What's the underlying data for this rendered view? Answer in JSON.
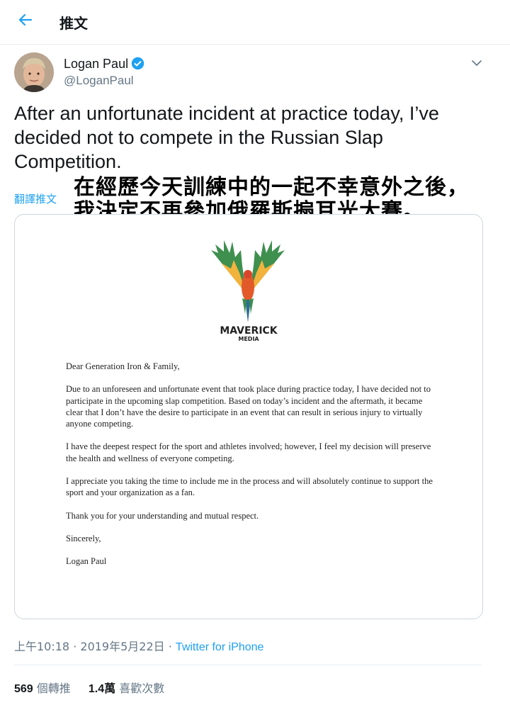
{
  "header": {
    "back_icon": "arrow-left-icon",
    "title": "推文"
  },
  "author": {
    "name": "Logan Paul",
    "handle": "@LoganPaul",
    "verified": true
  },
  "tweet": {
    "text": "After an unfortunate incident at practice today, I’ve decided not to compete in the Russian Slap Competition.",
    "translate_label": "翻譯推文",
    "overlay_caption": [
      "在經歷今天訓練中的一起不幸意外之後，",
      "我決定不再參加俄羅斯搧耳光大賽。"
    ]
  },
  "image": {
    "brand": "MAVERICK",
    "brand_sub": "MEDIA",
    "letter": [
      "Dear Generation Iron & Family,",
      "Due to an unforeseen and unfortunate event that took place during practice today, I have decided not to participate in the upcoming slap competition. Based on today’s incident and the aftermath, it became clear that I don’t have the desire to participate in an event that can result in serious injury to virtually anyone competing.",
      "I have the deepest respect for the sport and athletes involved; however, I feel my decision will preserve the health and wellness of everyone competing.",
      "I appreciate you taking the time to include me in the process and will absolutely continue to support the sport and your organization as a fan.",
      "Thank you for your understanding and mutual respect.",
      "Sincerely,",
      "Logan Paul"
    ]
  },
  "meta": {
    "time": "上午10:18",
    "separator": " · ",
    "date": "2019年5月22日",
    "source": "Twitter for iPhone"
  },
  "stats": {
    "retweets": "569",
    "retweets_label": "個轉推",
    "likes": "1.4萬",
    "likes_label": "喜歡次數"
  },
  "colors": {
    "accent": "#1da1f2",
    "muted": "#657786",
    "border": "#e6ecf0"
  }
}
